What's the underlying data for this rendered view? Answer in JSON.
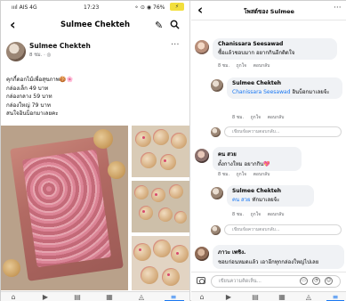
{
  "left_status": {
    "signal": "ıııl AIS 4G",
    "time": "17:23",
    "icons": "⚬ ⊙ ◉ 76%",
    "battery": "⚡"
  },
  "left_nav": {
    "back": "‹",
    "title": "Sulmee Chekteh",
    "edit_icon": "pencil-icon",
    "search_icon": "search-icon"
  },
  "post": {
    "author": "Sulmee Chekteh",
    "meta": "8 ชม. · ◎",
    "more": "···",
    "lines": [
      "คุกกี้ดอกไม้เพื่อสุขภาพ🍪🌸",
      "กล่องเล็ก 49 บาท",
      "กล่องกลาง 59 บาท",
      "กล่องใหญ่ 79 บาท",
      "สนใจอินบ็อกมาเลยคะ"
    ]
  },
  "left_tabs": [
    "⌂",
    "▶",
    "▤",
    "▦",
    "◬",
    "≡"
  ],
  "right_nav": {
    "back": "‹",
    "title": "โพสต์ของ Sulmee",
    "more": "···"
  },
  "comments": [
    {
      "name": "Chanissara Seesawad",
      "text": "ซื้อแล้วชอบมาก อยากกินอีกติดใจ",
      "time": "8 ชม.",
      "like": "ถูกใจ",
      "reply": "ตอบกลับ"
    },
    {
      "name": "Sulmee Chekteh",
      "tag": "Chanissara Seesawad",
      "text": "อินบ็อกมาเลยจ้ะ",
      "time": "8 ชม.",
      "like": "ถูกใจ",
      "reply": "ตอบกลับ"
    },
    {
      "name": "คน สวย",
      "text": "ตั้งกางใหม อยากกิน💖",
      "time": "8 ชม.",
      "like": "ถูกใจ",
      "reply": "ตอบกลับ"
    },
    {
      "name": "Sulmee Chekteh",
      "tag": "คน สวย",
      "text": "ทักมาเลยจ้ะ",
      "time": "8 ชม.",
      "like": "ถูกใจ",
      "reply": "ตอบกลับ"
    },
    {
      "name": "ภาวะ เพชิง.",
      "text": "ชอบก่อนหมดแล้ว เอาอีกทุกกล่องใหญ่ไปเลย",
      "time": "",
      "like": "",
      "reply": ""
    }
  ],
  "reply_placeholder": "เขียนข้อความตอบกลับ...",
  "comment_placeholder": "เขียนความคิดเห็น...",
  "right_tabs": [
    "⌂",
    "▶",
    "▤",
    "▦",
    "◬",
    "≡"
  ]
}
